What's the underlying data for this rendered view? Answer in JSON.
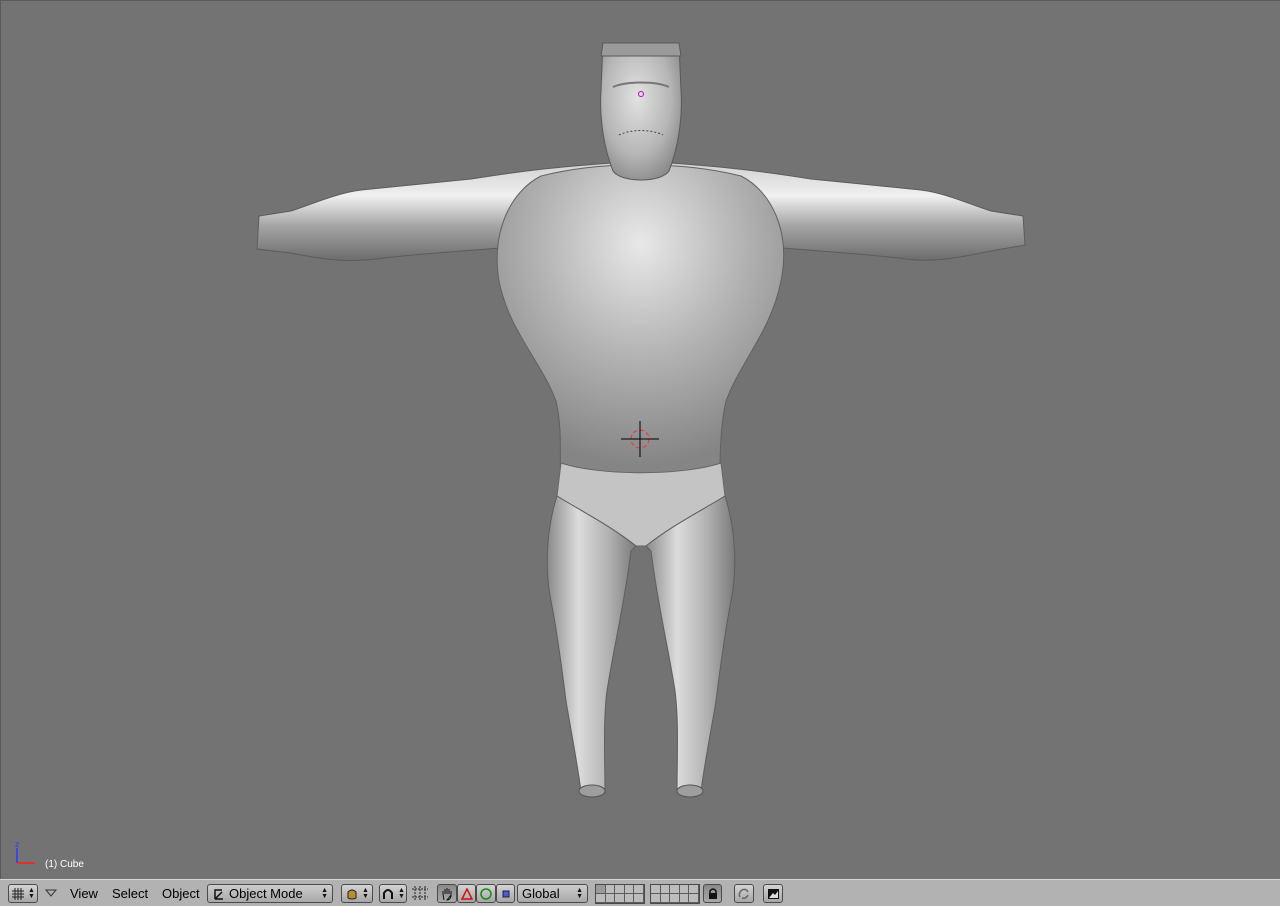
{
  "viewport": {
    "object_info": "(1) Cube",
    "axis_label": "z"
  },
  "header": {
    "window_type_icon": "grid-icon",
    "menus": {
      "view": "View",
      "select": "Select",
      "object": "Object"
    },
    "mode": {
      "label": "Object Mode",
      "icon": "object-mode-icon"
    },
    "draw_type_icon": "shaded-teapot-icon",
    "pivot_icon": "pivot-icon",
    "transform_manipulators": {
      "hand_icon": "hand-icon",
      "translate_icon": "translate-icon",
      "rotate_icon": "rotate-icon",
      "scale_icon": "scale-icon"
    },
    "orientation": {
      "label": "Global"
    },
    "lock_icon": "lock-icon",
    "scene_lock_icon": "scene-lock-icon",
    "render_icon": "render-icon"
  },
  "colors": {
    "viewport_bg": "#737373",
    "header_bg": "#b2b2b2",
    "mesh_light": "#d4d4d4",
    "mesh_mid": "#a0a0a0",
    "mesh_dark": "#6e6e6e",
    "axis_blue": "#2a3aff",
    "axis_red": "#ff2020"
  }
}
